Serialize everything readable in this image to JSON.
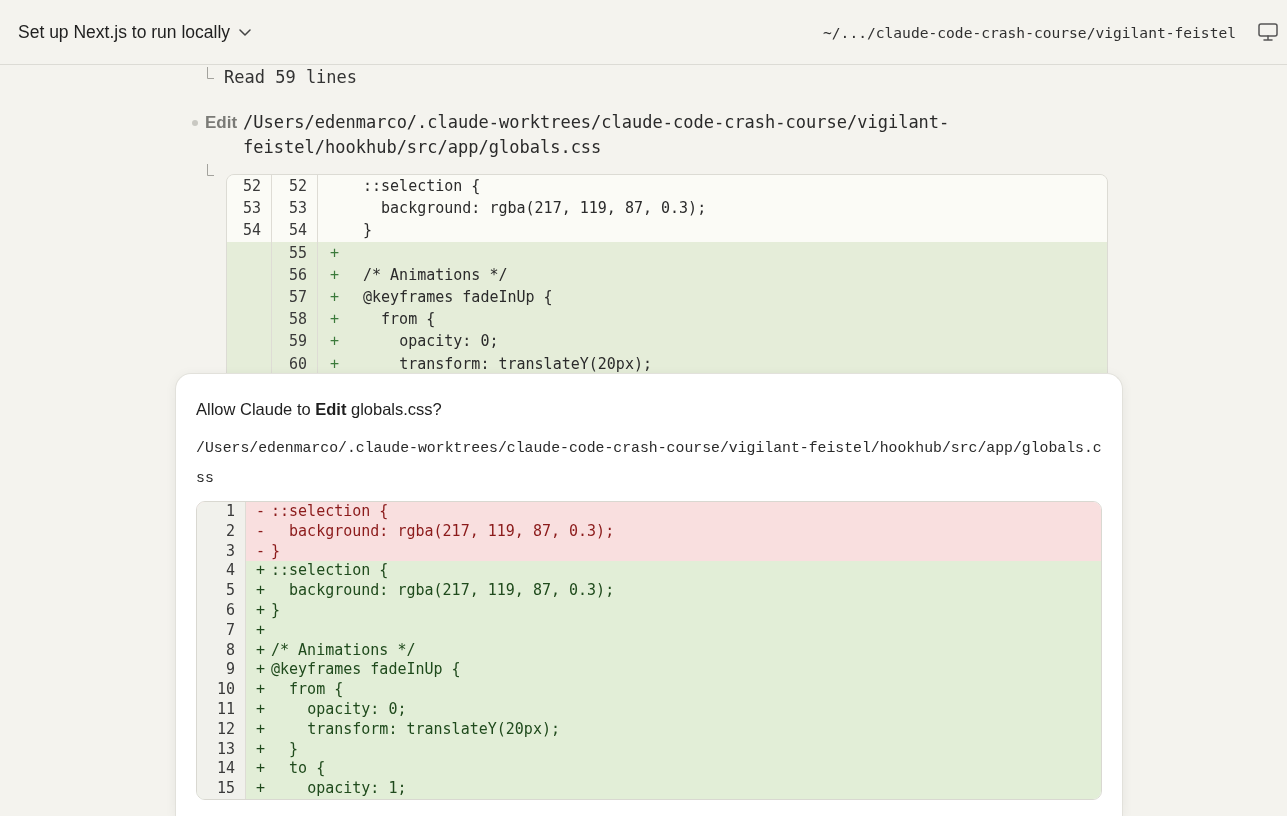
{
  "header": {
    "title": "Set up Next.js to run locally",
    "path": "~/.../claude-code-crash-course/vigilant-feistel"
  },
  "transcript": [
    {
      "kind": "result",
      "text": "Read 59 lines"
    },
    {
      "kind": "tool",
      "tool": "Edit",
      "path": "/Users/edenmarco/.claude-worktrees/claude-code-crash-course/vigilant-feistel/hookhub/src/app/globals.css",
      "diff": [
        {
          "kind": "context",
          "old": "52",
          "new": "52",
          "code": "::selection {"
        },
        {
          "kind": "context",
          "old": "53",
          "new": "53",
          "code": "  background: rgba(217, 119, 87, 0.3);"
        },
        {
          "kind": "context",
          "old": "54",
          "new": "54",
          "code": "}"
        },
        {
          "kind": "added",
          "new": "55",
          "sign": "+"
        },
        {
          "kind": "added",
          "new": "56",
          "sign": "+",
          "code": "/* Animations */"
        },
        {
          "kind": "added",
          "new": "57",
          "sign": "+",
          "code": "@keyframes fadeInUp {"
        },
        {
          "kind": "added",
          "new": "58",
          "sign": "+",
          "code": "  from {"
        },
        {
          "kind": "added",
          "new": "59",
          "sign": "+",
          "code": "    opacity: 0;"
        },
        {
          "kind": "added",
          "new": "60",
          "sign": "+",
          "code": "    transform: translateY(20px);"
        }
      ]
    }
  ],
  "dialog": {
    "title": "Allow Claude to **Edit** globals.css?",
    "path": "/Users/edenmarco/.claude-worktrees/claude-code-crash-course/vigilant-feistel/hookhub/src/app/globals.css",
    "diff": [
      {
        "kind": "removed",
        "line": "1",
        "sign": "-",
        "code": "::selection {"
      },
      {
        "kind": "removed",
        "line": "2",
        "sign": "-",
        "code": "  background: rgba(217, 119, 87, 0.3);"
      },
      {
        "kind": "removed",
        "line": "3",
        "sign": "-",
        "code": "}"
      },
      {
        "kind": "added",
        "line": "4",
        "sign": "+",
        "code": "::selection {"
      },
      {
        "kind": "added",
        "line": "5",
        "sign": "+",
        "code": "  background: rgba(217, 119, 87, 0.3);"
      },
      {
        "kind": "added",
        "line": "6",
        "sign": "+",
        "code": "}"
      },
      {
        "kind": "added",
        "line": "7",
        "sign": "+"
      },
      {
        "kind": "added",
        "line": "8",
        "sign": "+",
        "code": "/* Animations */"
      },
      {
        "kind": "added",
        "line": "9",
        "sign": "+",
        "code": "@keyframes fadeInUp {"
      },
      {
        "kind": "added",
        "line": "10",
        "sign": "+",
        "code": "  from {"
      },
      {
        "kind": "added",
        "line": "11",
        "sign": "+",
        "code": "    opacity: 0;"
      },
      {
        "kind": "added",
        "line": "12",
        "sign": "+",
        "code": "    transform: translateY(20px);"
      },
      {
        "kind": "added",
        "line": "13",
        "sign": "+",
        "code": "  }"
      },
      {
        "kind": "added",
        "line": "14",
        "sign": "+",
        "code": "  to {"
      },
      {
        "kind": "added",
        "line": "15",
        "sign": "+",
        "code": "    opacity: 1;"
      }
    ]
  }
}
